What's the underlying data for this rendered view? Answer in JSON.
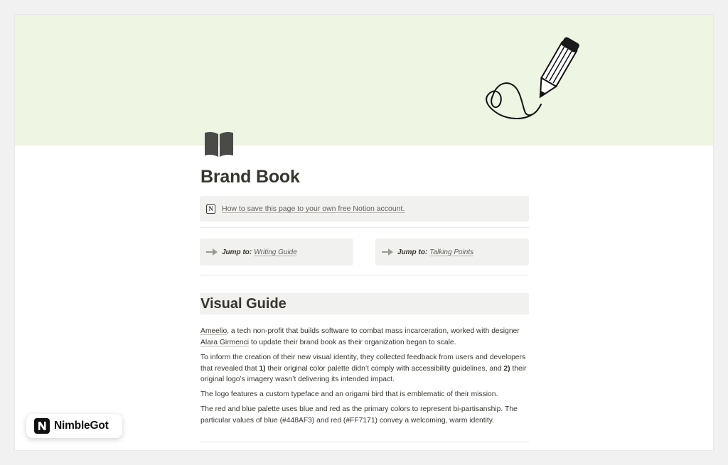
{
  "page": {
    "cover_color": "#eef5e2",
    "cover_art_icon": "heart-pencil-doodle",
    "page_icon": "open-book-icon",
    "title": "Brand Book"
  },
  "callout": {
    "icon": "notion-icon",
    "icon_letter": "N",
    "link_text": "How to save this page to your own free Notion account."
  },
  "jump_links": [
    {
      "label": "Jump to:",
      "target": "Writing Guide"
    },
    {
      "label": "Jump to:",
      "target": "Talking Points"
    }
  ],
  "section": {
    "heading": "Visual Guide",
    "paragraphs": {
      "p1": {
        "link1": "Ameelio",
        "text1": ", a tech non-profit that builds software to combat mass incarceration, worked with designer ",
        "link2": "Alara Girmenci",
        "text2": " to update their brand book as their organization began to scale."
      },
      "p2": {
        "text1": "To inform the creation of their new visual identity, they collected feedback from users and developers that revealed that ",
        "bold1": "1)",
        "text2": " their original color palette didn’t comply with accessibility guidelines, and ",
        "bold2": "2)",
        "text3": " their original logo’s imagery wasn’t delivering its intended impact."
      },
      "p3": "The logo features a custom typeface and an origami bird that is emblematic of their mission.",
      "p4": "The red and blue palette uses blue and red as the primary colors to represent bi-partisanship. The particular values of blue (#448AF3) and red (#FF7171) convey a welcoming, warm identity."
    }
  },
  "badge": {
    "logo": "nimblegot-logo",
    "text": "NimbleGot"
  }
}
